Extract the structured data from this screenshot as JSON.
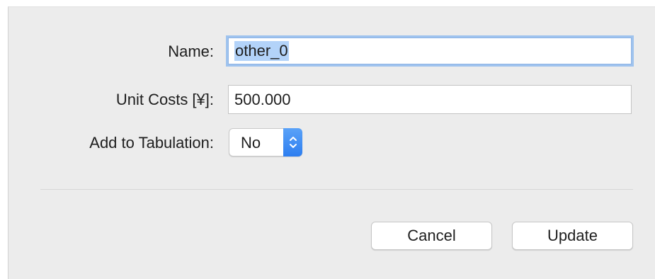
{
  "form": {
    "name": {
      "label": "Name:",
      "value": "other_0"
    },
    "unit_costs": {
      "label": "Unit Costs [¥]:",
      "value": "500.000"
    },
    "add_to_tabulation": {
      "label": "Add to Tabulation:",
      "selected": "No"
    }
  },
  "buttons": {
    "cancel": "Cancel",
    "update": "Update"
  },
  "colors": {
    "dialog_background": "#ececec",
    "focus_ring": "#9fc3ee",
    "selection": "#b3d3f9",
    "popup_accent": "#2d7ef0"
  },
  "icons": {
    "popup_arrows": "chevron-up-down-icon"
  }
}
